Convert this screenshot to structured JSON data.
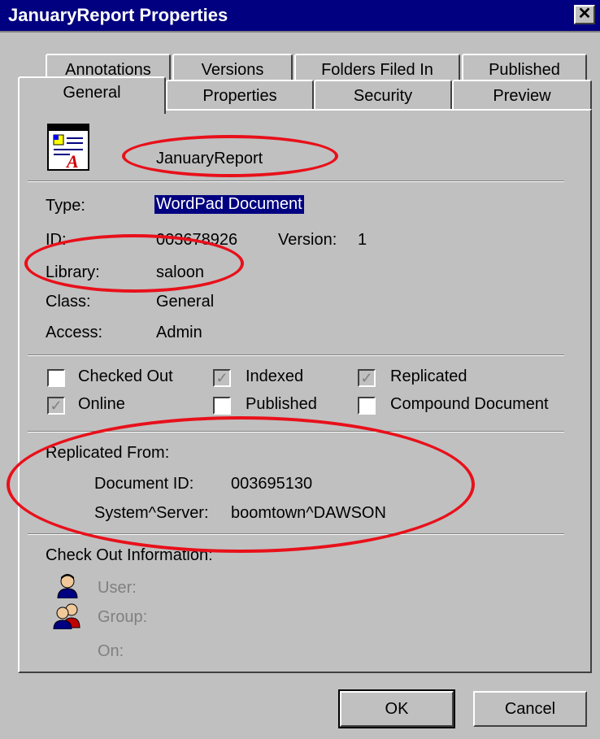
{
  "window": {
    "title": "JanuaryReport Properties"
  },
  "tabs": {
    "back": [
      "Annotations",
      "Versions",
      "Folders Filed In",
      "Published"
    ],
    "front": [
      "General",
      "Properties",
      "Security",
      "Preview"
    ],
    "active": "General"
  },
  "general": {
    "name": "JanuaryReport",
    "type_label": "Type:",
    "type_value": "WordPad Document",
    "id_label": "ID:",
    "id_value": "003678926",
    "version_label": "Version:",
    "version_value": "1",
    "library_label": "Library:",
    "library_value": "saloon",
    "class_label": "Class:",
    "class_value": "General",
    "access_label": "Access:",
    "access_value": "Admin"
  },
  "flags": [
    {
      "label": "Checked Out",
      "checked": false
    },
    {
      "label": "Indexed",
      "checked": true
    },
    {
      "label": "Replicated",
      "checked": true
    },
    {
      "label": "Online",
      "checked": true
    },
    {
      "label": "Published",
      "checked": false
    },
    {
      "label": "Compound Document",
      "checked": false
    }
  ],
  "replicated": {
    "heading": "Replicated From:",
    "doc_id_label": "Document ID:",
    "doc_id_value": "003695130",
    "server_label": "System^Server:",
    "server_value": "boomtown^DAWSON"
  },
  "checkout": {
    "heading": "Check Out Information:",
    "user_label": "User:",
    "group_label": "Group:",
    "on_label": "On:"
  },
  "buttons": {
    "ok": "OK",
    "cancel": "Cancel"
  },
  "colors": {
    "title_bar": "#000080",
    "dialog": "#c0c0c0",
    "highlight_ellipse": "#e8101a"
  }
}
